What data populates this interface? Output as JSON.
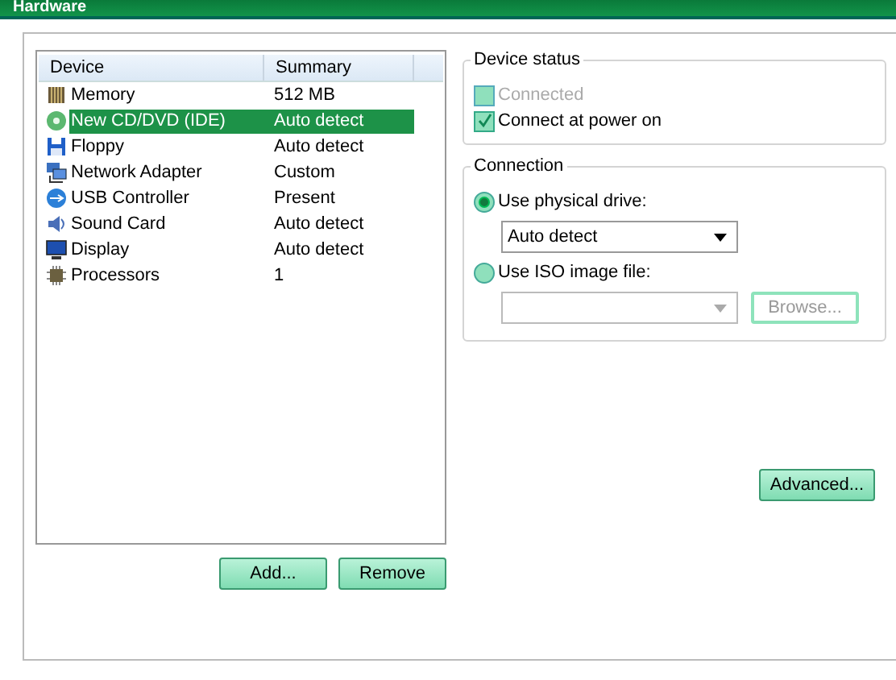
{
  "window": {
    "title": "Hardware"
  },
  "device_list": {
    "columns": [
      "Device",
      "Summary"
    ],
    "rows": [
      {
        "kind": "memory",
        "device": "Memory",
        "summary": "512 MB",
        "selected": false
      },
      {
        "kind": "cdrom",
        "device": "New CD/DVD (IDE)",
        "summary": "Auto detect",
        "selected": true
      },
      {
        "kind": "floppy",
        "device": "Floppy",
        "summary": "Auto detect",
        "selected": false
      },
      {
        "kind": "network",
        "device": "Network Adapter",
        "summary": "Custom",
        "selected": false
      },
      {
        "kind": "usb",
        "device": "USB Controller",
        "summary": "Present",
        "selected": false
      },
      {
        "kind": "sound",
        "device": "Sound Card",
        "summary": "Auto detect",
        "selected": false
      },
      {
        "kind": "display",
        "device": "Display",
        "summary": "Auto detect",
        "selected": false
      },
      {
        "kind": "cpu",
        "device": "Processors",
        "summary": "1",
        "selected": false
      }
    ]
  },
  "list_buttons": [
    {
      "label": "Add..."
    },
    {
      "label": "Remove"
    }
  ],
  "device_status": {
    "title": "Device status",
    "options": [
      {
        "label": "Connected",
        "checked": false,
        "disabled": true
      },
      {
        "label": "Connect at power on",
        "checked": true,
        "disabled": false
      }
    ]
  },
  "connection": {
    "title": "Connection",
    "physical": {
      "label": "Use physical drive:",
      "selected": true,
      "value": "Auto detect"
    },
    "iso": {
      "label": "Use ISO image file:",
      "selected": false,
      "field_disabled": true,
      "browse": {
        "label": "Browse...",
        "disabled": true
      }
    }
  },
  "advanced_button": {
    "label": "Advanced..."
  }
}
